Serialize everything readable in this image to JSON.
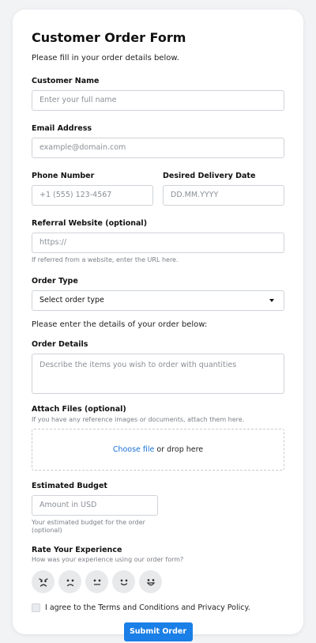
{
  "form": {
    "title": "Customer Order Form",
    "subtitle": "Please fill in your order details below.",
    "customer_name": {
      "label": "Customer Name",
      "placeholder": "Enter your full name"
    },
    "email": {
      "label": "Email Address",
      "placeholder": "example@domain.com"
    },
    "phone": {
      "label": "Phone Number",
      "placeholder": "+1 (555) 123-4567"
    },
    "delivery_date": {
      "label": "Desired Delivery Date",
      "placeholder": "DD.MM.YYYY"
    },
    "referral": {
      "label": "Referral Website (optional)",
      "placeholder": "https://",
      "help": "If referred from a website, enter the URL here."
    },
    "order_type": {
      "label": "Order Type",
      "selected": "Select order type"
    },
    "details_intro": "Please enter the details of your order below:",
    "order_details": {
      "label": "Order Details",
      "placeholder": "Describe the items you wish to order with quantities"
    },
    "attach": {
      "label": "Attach Files (optional)",
      "help": "If you have any reference images or documents, attach them here.",
      "choose_link": "Choose file",
      "drop_text": " or drop here"
    },
    "budget": {
      "label": "Estimated Budget",
      "placeholder": "Amount in USD",
      "help_line1": "Your estimated budget for the order",
      "help_line2": "(optional)"
    },
    "rating": {
      "label": "Rate Your Experience",
      "help": "How was your experience using our order form?",
      "options": [
        "very-dissatisfied-face-icon",
        "dissatisfied-face-icon",
        "neutral-face-icon",
        "satisfied-face-icon",
        "very-satisfied-face-icon"
      ]
    },
    "terms": {
      "label": "I agree to the Terms and Conditions and Privacy Policy."
    },
    "submit_label": "Submit Order"
  },
  "colors": {
    "accent": "#1a7fe6",
    "link": "#1a73d9",
    "background": "#f2f3f5"
  }
}
